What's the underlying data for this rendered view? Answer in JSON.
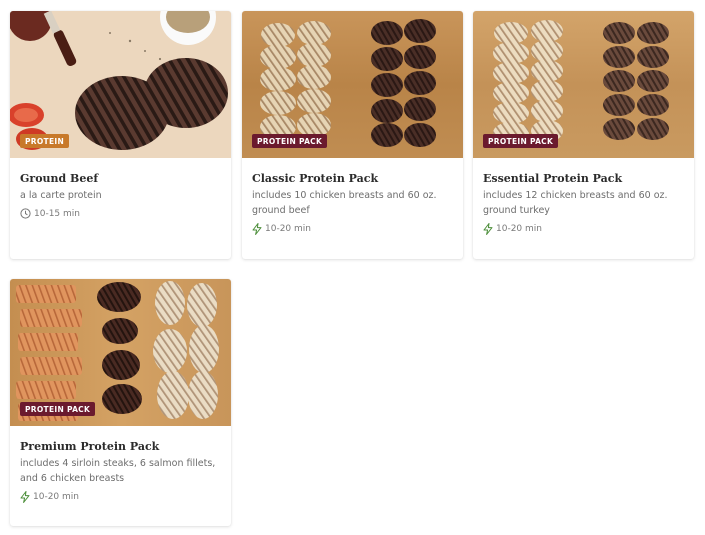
{
  "colors": {
    "badge_protein": "#c8792a",
    "badge_pack": "#6b1a2e",
    "bolt_icon": "#4d8f3b",
    "clock_icon": "#777777"
  },
  "cards": [
    {
      "title": "Ground Beef",
      "description": "a la carte protein",
      "badge": "PROTEIN",
      "time": "10-15 min",
      "time_icon": "clock-icon"
    },
    {
      "title": "Classic Protein Pack",
      "description": "includes 10 chicken breasts and 60 oz. ground beef",
      "badge": "PROTEIN PACK",
      "time": "10-20 min",
      "time_icon": "lightning-bolt-icon"
    },
    {
      "title": "Essential Protein Pack",
      "description": "includes 12 chicken breasts and 60 oz. ground turkey",
      "badge": "PROTEIN PACK",
      "time": "10-20 min",
      "time_icon": "lightning-bolt-icon"
    },
    {
      "title": "Premium Protein Pack",
      "description": "includes 4 sirloin steaks, 6 salmon fillets, and 6 chicken breasts",
      "badge": "PROTEIN PACK",
      "time": "10-20 min",
      "time_icon": "lightning-bolt-icon"
    }
  ]
}
